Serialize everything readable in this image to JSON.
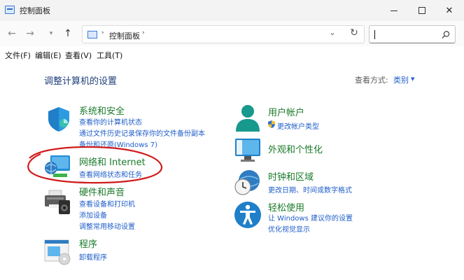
{
  "window": {
    "title": "控制面板"
  },
  "address": {
    "path": "控制面板",
    "sep": "›",
    "search_placeholder": ""
  },
  "menu": [
    "文件(F)",
    "编辑(E)",
    "查看(V)",
    "工具(T)"
  ],
  "page": {
    "title": "调整计算机的设置",
    "viewby_label": "查看方式:",
    "viewby_value": "类别"
  },
  "left": [
    {
      "title": "系统和安全",
      "icon": "shield-icon",
      "links": [
        "查看你的计算机状态",
        "通过文件历史记录保存你的文件备份副本",
        "备份和还原(Windows 7)"
      ]
    },
    {
      "title": "网络和 Internet",
      "icon": "network-globe-icon",
      "links": [
        "查看网络状态和任务"
      ]
    },
    {
      "title": "硬件和声音",
      "icon": "printer-speaker-icon",
      "links": [
        "查看设备和打印机",
        "添加设备",
        "调整常用移动设置"
      ]
    },
    {
      "title": "程序",
      "icon": "programs-icon",
      "links": [
        "卸载程序"
      ]
    }
  ],
  "right": [
    {
      "title": "用户帐户",
      "icon": "user-icon",
      "links": [
        "更改帐户类型"
      ]
    },
    {
      "title": "外观和个性化",
      "icon": "monitor-icon",
      "links": []
    },
    {
      "title": "时钟和区域",
      "icon": "clock-globe-icon",
      "links": [
        "更改日期、时间或数字格式"
      ]
    },
    {
      "title": "轻松使用",
      "icon": "accessibility-icon",
      "links": [
        "让 Windows 建议你的设置",
        "优化视觉显示"
      ]
    }
  ],
  "colors": {
    "link": "#1f5ec9",
    "category": "#1a7a2a",
    "annotation": "#d01c1c"
  }
}
